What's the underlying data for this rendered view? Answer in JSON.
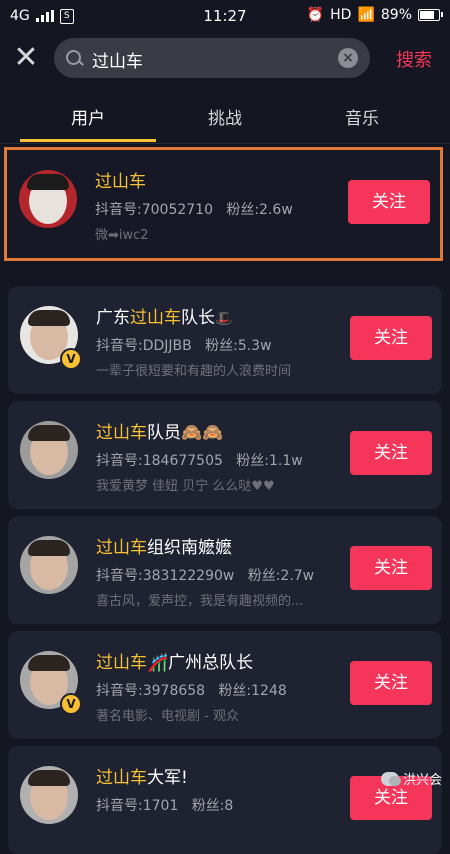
{
  "status_bar": {
    "network": "4G",
    "app_badge": "S",
    "time": "11:27",
    "hd": "HD",
    "battery": "89%"
  },
  "search": {
    "value": "过山车",
    "button_label": "搜索"
  },
  "tabs": [
    {
      "label": "用户",
      "active": true
    },
    {
      "label": "挑战",
      "active": false
    },
    {
      "label": "音乐",
      "active": false
    }
  ],
  "results": [
    {
      "name_highlight": "过山车",
      "name_rest": "",
      "douyin_label": "抖音号:70052710",
      "fans_label": "粉丝:2.6w",
      "bio": "微➡iwc2",
      "follow_label": "关注",
      "verified": false
    },
    {
      "name_prefix": "广东",
      "name_highlight": "过山车",
      "name_rest": "队长",
      "douyin_label": "抖音号:DDJJBB",
      "fans_label": "粉丝:5.3w",
      "bio": "一辈子很短要和有趣的人浪费时间",
      "follow_label": "关注",
      "verified": true
    },
    {
      "name_highlight": "过山车",
      "name_rest": "队员🙈🙈",
      "douyin_label": "抖音号:184677505",
      "fans_label": "粉丝:1.1w",
      "bio": "我爱黄梦 佳妞 贝宁 么么哒♥♥",
      "follow_label": "关注",
      "verified": false
    },
    {
      "name_highlight": "过山车",
      "name_rest": "组织南嬷嬷",
      "douyin_label": "抖音号:383122290w",
      "fans_label": "粉丝:2.7w",
      "bio": "喜古风，爱声控，我是有趣视频的...",
      "follow_label": "关注",
      "verified": false
    },
    {
      "name_highlight": "过山车",
      "name_rest": "🎢广州总队长",
      "douyin_label": "抖音号:3978658",
      "fans_label": "粉丝:1248",
      "bio": "著名电影、电视剧 - 观众",
      "follow_label": "关注",
      "verified": true
    },
    {
      "name_highlight": "过山车",
      "name_rest": "大军!",
      "douyin_label": "抖音号:1701",
      "fans_label": "粉丝:8",
      "bio": "",
      "follow_label": "关注",
      "verified": false
    }
  ],
  "watermark": "洪兴会",
  "colors": {
    "background": "#141722",
    "card": "#1f2230",
    "accent_red": "#f5365a",
    "accent_yellow": "#f7c035",
    "highlight_border": "#e07a3a"
  }
}
